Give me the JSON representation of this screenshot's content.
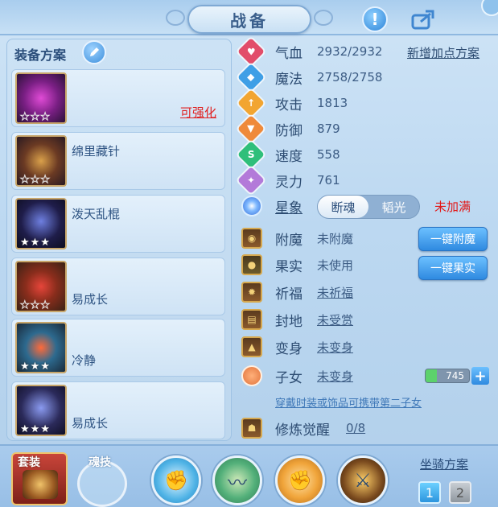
{
  "header": {
    "title": "战备"
  },
  "left": {
    "title": "装备方案",
    "items": [
      {
        "name": "",
        "stars_lit": 0,
        "upgrade": "可强化"
      },
      {
        "name": "绵里藏针",
        "stars_lit": 0
      },
      {
        "name": "泼天乱棍",
        "stars_lit": 3
      },
      {
        "name": "易成长",
        "stars_lit": 0
      },
      {
        "name": "冷静",
        "stars_lit": 3
      },
      {
        "name": "易成长",
        "stars_lit": 3
      }
    ]
  },
  "stats": {
    "add_plan": "新增加点方案",
    "rows": [
      {
        "label": "气血",
        "value": "2932/2932",
        "icon": "heart-icon",
        "color": "#e24d6a"
      },
      {
        "label": "魔法",
        "value": "2758/2758",
        "icon": "mana-icon",
        "color": "#3f9fe6"
      },
      {
        "label": "攻击",
        "value": "1813",
        "icon": "attack-icon",
        "color": "#f2a531"
      },
      {
        "label": "防御",
        "value": "879",
        "icon": "defense-icon",
        "color": "#ef8a3a"
      },
      {
        "label": "速度",
        "value": "558",
        "icon": "speed-icon",
        "color": "#2fbf7a"
      },
      {
        "label": "灵力",
        "value": "761",
        "icon": "spirit-icon",
        "color": "#b37ad9"
      }
    ]
  },
  "constellation": {
    "label": "星象",
    "option_a": "断魂",
    "option_b": "韬光",
    "status": "未加满"
  },
  "enhance": {
    "rows": [
      {
        "label": "附魔",
        "value": "未附魔",
        "icon": "enchant-icon"
      },
      {
        "label": "果实",
        "value": "未使用",
        "icon": "fruit-icon"
      },
      {
        "label": "祈福",
        "value": "未祈福",
        "icon": "blessing-icon"
      },
      {
        "label": "封地",
        "value": "未受赏",
        "icon": "fief-icon"
      },
      {
        "label": "变身",
        "value": "未变身",
        "icon": "transform-icon"
      },
      {
        "label": "子女",
        "value": "未变身",
        "icon": "child-icon"
      }
    ],
    "btn_enchant": "一键附魔",
    "btn_fruit": "一键果实",
    "pet_value": "745",
    "plus": "+",
    "hint": "穿戴时装或饰品可携带第二子女",
    "awaken_label": "修炼觉醒",
    "awaken_value": "0/8"
  },
  "bottom": {
    "suit": "套装",
    "soul": "魂技",
    "mount_title": "坐骑方案",
    "mount_1": "1",
    "mount_2": "2"
  },
  "colors": {
    "accent": "#2f8ae0",
    "warning": "#e21818"
  }
}
